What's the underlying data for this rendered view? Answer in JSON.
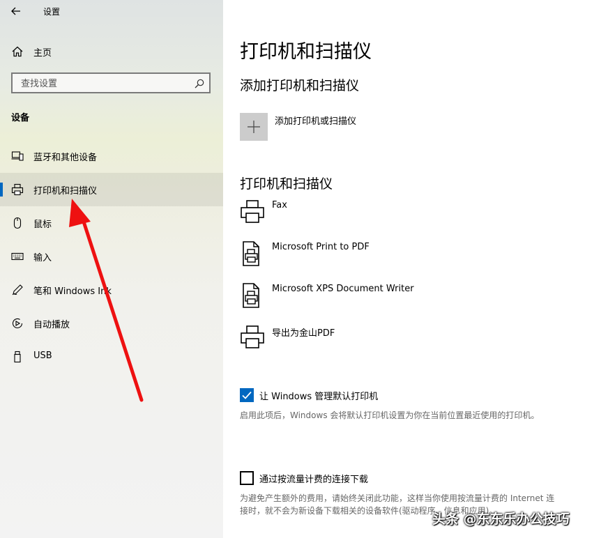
{
  "window": {
    "title": "设置"
  },
  "sidebar": {
    "home_label": "主页",
    "search": {
      "placeholder": "查找设置",
      "value": ""
    },
    "section": "设备",
    "items": [
      {
        "label": "蓝牙和其他设备",
        "icon": "bluetooth-devices-icon"
      },
      {
        "label": "打印机和扫描仪",
        "icon": "printer-icon",
        "selected": true
      },
      {
        "label": "鼠标",
        "icon": "mouse-icon"
      },
      {
        "label": "输入",
        "icon": "keyboard-icon"
      },
      {
        "label": "笔和 Windows Ink",
        "icon": "pen-icon"
      },
      {
        "label": "自动播放",
        "icon": "autoplay-icon"
      },
      {
        "label": "USB",
        "icon": "usb-icon"
      }
    ]
  },
  "main": {
    "title": "打印机和扫描仪",
    "add_section": {
      "heading": "添加打印机和扫描仪",
      "button_label": "添加打印机或扫描仪"
    },
    "printers_section": {
      "heading": "打印机和扫描仪",
      "printers": [
        {
          "name": "Fax",
          "icon": "fax-printer-icon"
        },
        {
          "name": "Microsoft Print to PDF",
          "icon": "document-printer-icon"
        },
        {
          "name": "Microsoft XPS Document Writer",
          "icon": "document-printer-icon"
        },
        {
          "name": "导出为金山PDF",
          "icon": "printer-icon"
        }
      ]
    },
    "default_printer": {
      "checked": true,
      "label": "让 Windows 管理默认打印机",
      "description": "启用此项后，Windows 会将默认打印机设置为你在当前位置最近使用的打印机。"
    },
    "metered": {
      "checked": false,
      "label": "通过按流量计费的连接下载",
      "description": "为避免产生额外的费用，请始终关闭此功能，这样当你使用按流量计费的 Internet 连接时，就不会为新设备下载相关的设备软件(驱动程序、信息和应用)。"
    }
  },
  "overlay": {
    "watermark": "头条 @东东乐办公技巧",
    "arrow_color": "#ee1111"
  },
  "colors": {
    "accent": "#0067c0"
  }
}
